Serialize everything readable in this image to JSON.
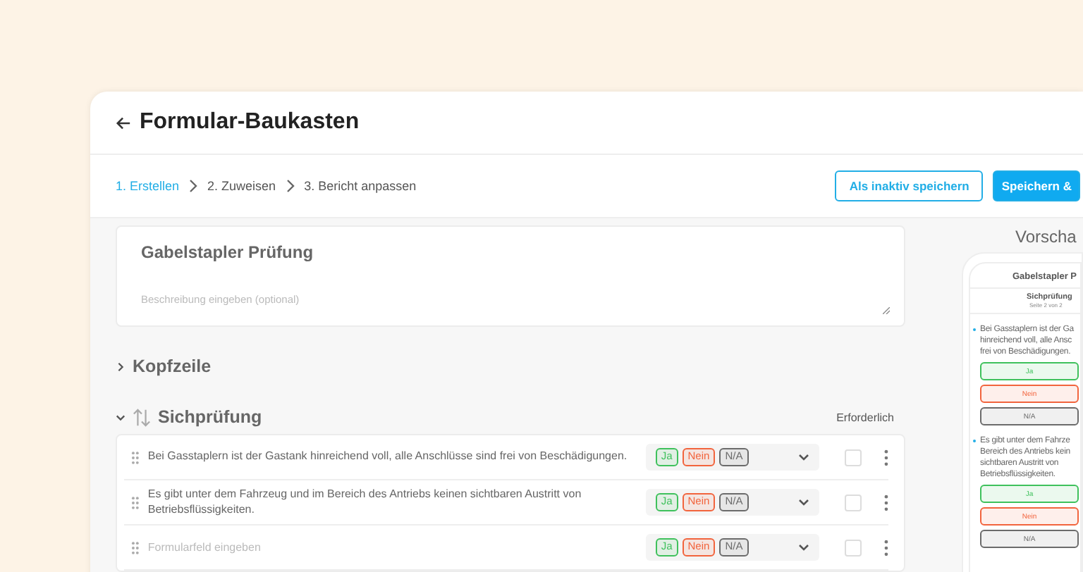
{
  "header": {
    "title": "Formular-Baukasten"
  },
  "steps": [
    {
      "label": "1. Erstellen",
      "selected": true
    },
    {
      "label": "2. Zuweisen",
      "selected": false
    },
    {
      "label": "3. Bericht anpassen",
      "selected": false
    }
  ],
  "actions": [
    {
      "label": "Als inaktiv speichern",
      "kind": "outline"
    },
    {
      "label": "Speichern &",
      "kind": "primary"
    }
  ],
  "form": {
    "title_value": "Gabelstapler Prüfung",
    "description_placeholder": "Beschreibung eingeben (optional)"
  },
  "sections": [
    {
      "title": "Kopfzeile",
      "expanded": false
    },
    {
      "title": "Sichprüfung",
      "expanded": true,
      "required_label": "Erforderlich",
      "questions": [
        {
          "text": "Bei Gasstaplern ist der Gastank hinreichend voll, alle Anschlüsse sind frei von Beschädigungen.",
          "required": false,
          "options": [
            {
              "label": "Ja",
              "color": "#3fc15c"
            },
            {
              "label": "Nein",
              "color": "#f2643d"
            },
            {
              "label": "N/A",
              "color": "#6b6b6b"
            }
          ]
        },
        {
          "text": "Es gibt unter dem Fahrzeug und im Bereich des Antriebs keinen sichtbaren Austritt von Betriebsflüssigkeiten.",
          "required": false,
          "options": [
            {
              "label": "Ja",
              "color": "#3fc15c"
            },
            {
              "label": "Nein",
              "color": "#f2643d"
            },
            {
              "label": "N/A",
              "color": "#6b6b6b"
            }
          ]
        },
        {
          "placeholder": "Formularfeld eingeben",
          "required": false,
          "options": [
            {
              "label": "Ja",
              "color": "#3fc15c"
            },
            {
              "label": "Nein",
              "color": "#f2643d"
            },
            {
              "label": "N/A",
              "color": "#6b6b6b"
            }
          ]
        }
      ]
    }
  ],
  "preview": {
    "heading": "Vorscha",
    "title": "Gabelstapler P",
    "section": "Sichprüfung",
    "page": "Seite 2 von 2",
    "questions": [
      {
        "lines": [
          "Bei Gasstaplern ist der Ga",
          "hinreichend voll, alle Ansc",
          "frei von Beschädigungen."
        ],
        "options": [
          {
            "label": "Ja",
            "color": "#3fc15c"
          },
          {
            "label": "Nein",
            "color": "#f2643d"
          },
          {
            "label": "N/A",
            "color": "#6b6b6b"
          }
        ]
      },
      {
        "lines": [
          "Es gibt unter dem Fahrze",
          "Bereich des Antriebs kein",
          "sichtbaren Austritt von",
          "Betriebsflüssigkeiten."
        ],
        "options": [
          {
            "label": "Ja",
            "color": "#3fc15c"
          },
          {
            "label": "Nein",
            "color": "#f2643d"
          },
          {
            "label": "N/A",
            "color": "#6b6b6b"
          }
        ]
      }
    ]
  }
}
